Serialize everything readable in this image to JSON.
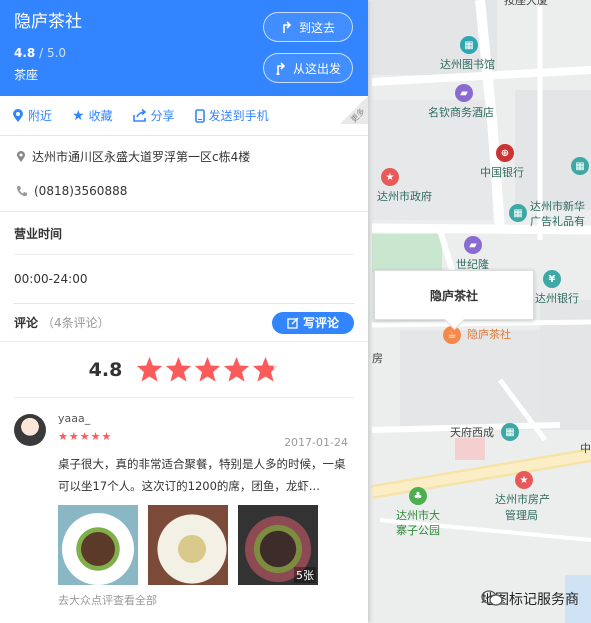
{
  "place": {
    "name": "隐庐茶社",
    "rating": "4.8",
    "rating_max": "/ 5.0",
    "category": "茶座",
    "btn_go": "到这去",
    "btn_from": "从这出发"
  },
  "actions": {
    "nearby": "附近",
    "favorite": "收藏",
    "share": "分享",
    "send_phone": "发送到手机",
    "more": "更多"
  },
  "address": "达州市通川区永盛大道罗浮第一区c栋4楼",
  "phone": "(0818)3560888",
  "hours_title": "营业时间",
  "hours": "00:00-24:00",
  "reviews": {
    "label": "评论",
    "count": "（4条评论）",
    "write": "写评论",
    "score": "4.8",
    "stars": 4.8,
    "item": {
      "user": "yaaa_",
      "date": "2017-01-24",
      "text": "桌子很大，真的非常适合聚餐，特别是人多的时候，一桌可以坐17个人。这次订的1200的席，团鱼，龙虾...",
      "photo_count": "5张",
      "more_link": "去大众点评查看全部"
    }
  },
  "map": {
    "info_title": "隐庐茶社",
    "poi_library": "达州图书馆",
    "poi_hotel": "名钦商务酒店",
    "poi_bank": "中国银行",
    "poi_gov": "达州市政府",
    "poi_xinhua1": "达州市新华",
    "poi_xinhua2": "广告礼品有",
    "poi_shijilong": "世纪隆",
    "poi_icbc": "达州银行",
    "poi_tea": "隐庐茶社",
    "poi_tianfu": "天府西成",
    "poi_house1": "达州市房产",
    "poi_house2": "管理局",
    "poi_park1": "达州市大",
    "poi_park2": "寨子公园",
    "poi_fang": "房",
    "poi_zhong": "中",
    "poi_top": "按座大厦"
  },
  "watermark": "地图标记服务商",
  "colors": {
    "accent": "#3385ff",
    "star": "#fb5b5b",
    "tea_pin": "#f5894b"
  }
}
